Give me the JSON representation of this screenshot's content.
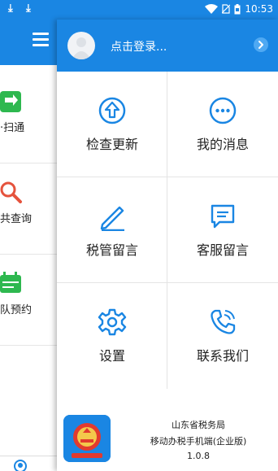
{
  "status_bar": {
    "time": "10:53"
  },
  "drawer": {
    "items": [
      {
        "label": "·扫通",
        "icon": "scan-icon"
      },
      {
        "label": "共查询",
        "icon": "search-icon"
      },
      {
        "label": "队预约",
        "icon": "calendar-icon"
      }
    ]
  },
  "header": {
    "login_prompt": "点击登录..."
  },
  "menu": [
    {
      "label": "检查更新",
      "icon": "update-icon"
    },
    {
      "label": "我的消息",
      "icon": "message-icon"
    },
    {
      "label": "税管留言",
      "icon": "edit-icon"
    },
    {
      "label": "客服留言",
      "icon": "chat-icon"
    },
    {
      "label": "设置",
      "icon": "settings-icon"
    },
    {
      "label": "联系我们",
      "icon": "phone-icon"
    }
  ],
  "footer": {
    "org": "山东省税务局",
    "app_name": "移动办税手机端(企业版)",
    "version": "1.0.8"
  },
  "colors": {
    "brand_blue": "#1a86e3",
    "green": "#2eb84f",
    "red": "#e5533d"
  }
}
